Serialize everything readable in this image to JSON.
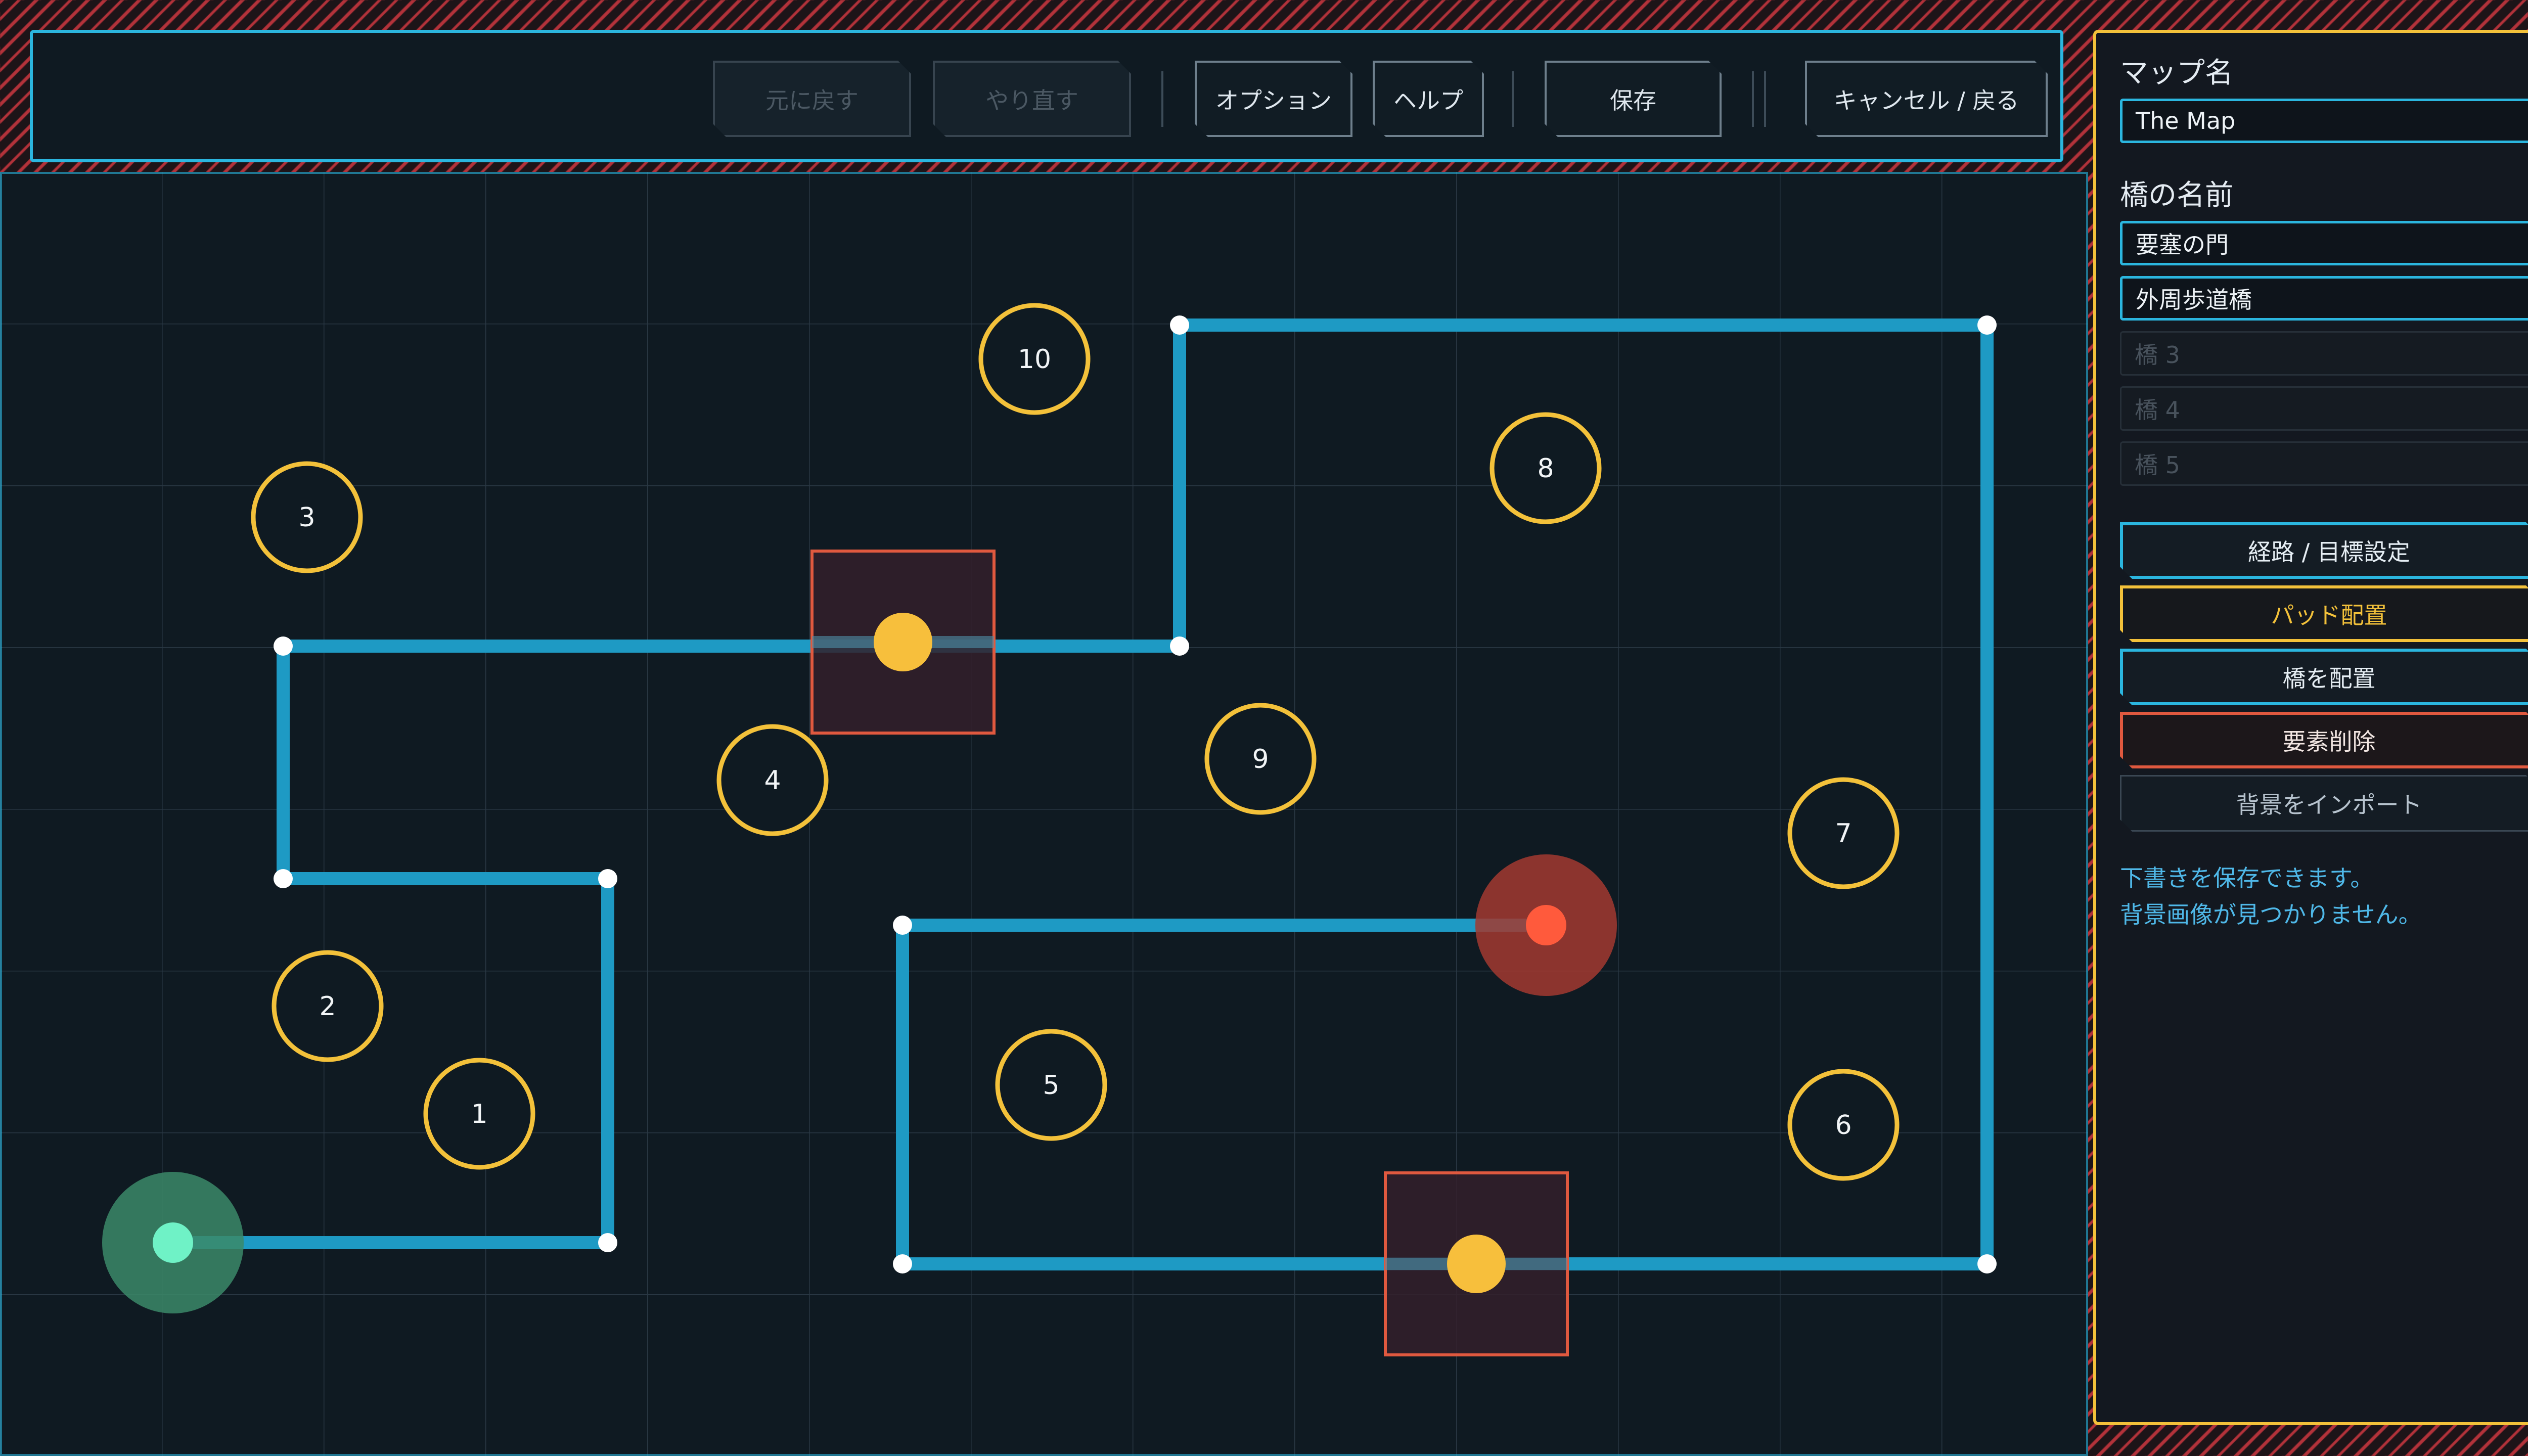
{
  "toolbar": {
    "undo_label": "元に戻す",
    "redo_label": "やり直す",
    "options_label": "オプション",
    "help_label": "ヘルプ",
    "save_label": "保存",
    "cancel_label": "キャンセル / 戻る"
  },
  "side_panel": {
    "map_name_heading": "マップ名",
    "map_name_value": "The Map",
    "bridge_names_heading": "橋の名前",
    "bridge_names": [
      {
        "value": "要塞の門",
        "enabled": true
      },
      {
        "value": "外周歩道橋",
        "enabled": true
      },
      {
        "value": "橋 3",
        "enabled": false
      },
      {
        "value": "橋 4",
        "enabled": false
      },
      {
        "value": "橋 5",
        "enabled": false
      }
    ],
    "tools": {
      "route_label": "経路 / 目標設定",
      "pad_label": "パッド配置",
      "bridge_label": "橋を配置",
      "delete_label": "要素削除",
      "import_label": "背景をインポート"
    },
    "status_lines": [
      "下書きを保存できます。",
      "背景画像が見つかりません。"
    ]
  },
  "map": {
    "pads": [
      {
        "label": "1"
      },
      {
        "label": "2"
      },
      {
        "label": "3"
      },
      {
        "label": "4"
      },
      {
        "label": "5"
      },
      {
        "label": "6"
      },
      {
        "label": "7"
      },
      {
        "label": "8"
      },
      {
        "label": "9"
      },
      {
        "label": "10"
      }
    ]
  },
  "colors": {
    "accent_cyan": "#2bb6df",
    "path_blue": "#1e9ac4",
    "pad_yellow": "#f3c13a",
    "danger_red": "#e0593f",
    "start_green": "#62f0c0",
    "end_red": "#ff5a3c",
    "background": "#0f1a22"
  }
}
